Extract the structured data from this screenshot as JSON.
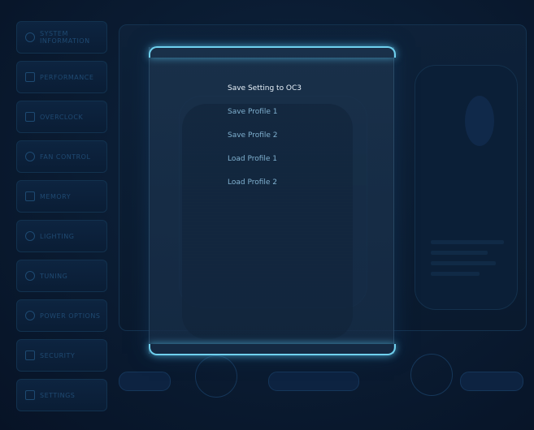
{
  "sidebar": {
    "items": [
      {
        "label": "SYSTEM INFORMATION",
        "icon": "info-icon"
      },
      {
        "label": "PERFORMANCE",
        "icon": "gauge-icon"
      },
      {
        "label": "OVERCLOCK",
        "icon": "cpu-icon"
      },
      {
        "label": "FAN CONTROL",
        "icon": "fan-icon"
      },
      {
        "label": "MEMORY",
        "icon": "memory-icon"
      },
      {
        "label": "LIGHTING",
        "icon": "gear-icon"
      },
      {
        "label": "TUNING",
        "icon": "tuning-icon"
      },
      {
        "label": "POWER OPTIONS",
        "icon": "power-icon"
      },
      {
        "label": "SECURITY",
        "icon": "lock-icon"
      },
      {
        "label": "SETTINGS",
        "icon": "settings-icon"
      }
    ]
  },
  "overlay_menu": {
    "items": [
      {
        "label": "Save Setting to OC3",
        "selected": true
      },
      {
        "label": "Save Profile 1",
        "selected": false
      },
      {
        "label": "Save Profile 2",
        "selected": false
      },
      {
        "label": "Load Profile 1",
        "selected": false
      },
      {
        "label": "Load Profile 2",
        "selected": false
      }
    ]
  },
  "colors": {
    "accent_glow": "#6fd0ee",
    "menu_selected": "#e8f2fa",
    "menu_normal": "#7fb0cf",
    "background": "#081628"
  }
}
